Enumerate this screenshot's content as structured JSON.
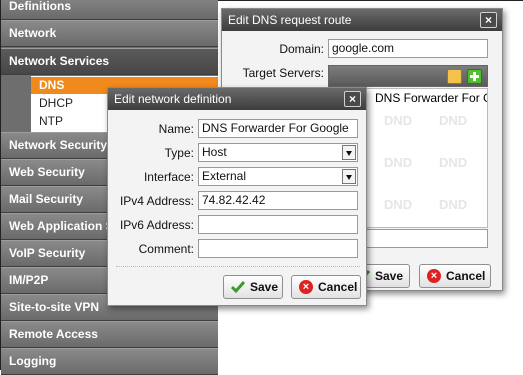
{
  "sidebar": {
    "items": [
      {
        "label": "Definitions"
      },
      {
        "label": "Network"
      },
      {
        "label": "Network Services"
      },
      {
        "label": "Network Security"
      },
      {
        "label": "Web Security"
      },
      {
        "label": "Mail Security"
      },
      {
        "label": "Web Application Security"
      },
      {
        "label": "VoIP Security"
      },
      {
        "label": "IM/P2P"
      },
      {
        "label": "Site-to-site VPN"
      },
      {
        "label": "Remote Access"
      },
      {
        "label": "Logging"
      }
    ],
    "sub_items": [
      {
        "label": "DNS"
      },
      {
        "label": "DHCP"
      },
      {
        "label": "NTP"
      }
    ]
  },
  "dns_dialog": {
    "title": "Edit DNS request route",
    "domain_label": "Domain:",
    "domain_value": "google.com",
    "target_servers_label": "Target Servers:",
    "target_server_item": "DNS Forwarder For G",
    "watermark": "DND",
    "save_label": "Save",
    "cancel_label": "Cancel",
    "close_glyph": "×"
  },
  "net_dialog": {
    "title": "Edit network definition",
    "close_glyph": "×",
    "fields": {
      "name_label": "Name:",
      "name_value": "DNS Forwarder For Google",
      "type_label": "Type:",
      "type_value": "Host",
      "interface_label": "Interface:",
      "interface_value": "External",
      "ipv4_label": "IPv4 Address:",
      "ipv4_value": "74.82.42.42",
      "ipv6_label": "IPv6 Address:",
      "ipv6_value": "",
      "comment_label": "Comment:",
      "comment_value": ""
    },
    "save_label": "Save",
    "cancel_label": "Cancel"
  },
  "icons": {
    "folder": "folder-icon",
    "add": "add-icon",
    "check": "check-icon",
    "cancel": "cancel-icon",
    "close": "close-icon",
    "dropdown": "chevron-down-icon"
  },
  "colors": {
    "accent_orange": "#f08a1c",
    "sidebar_gray": "#6e6e6e",
    "title_bar": "#3d3d3d",
    "save_green": "#3a9a2a",
    "cancel_red": "#dd2222"
  }
}
